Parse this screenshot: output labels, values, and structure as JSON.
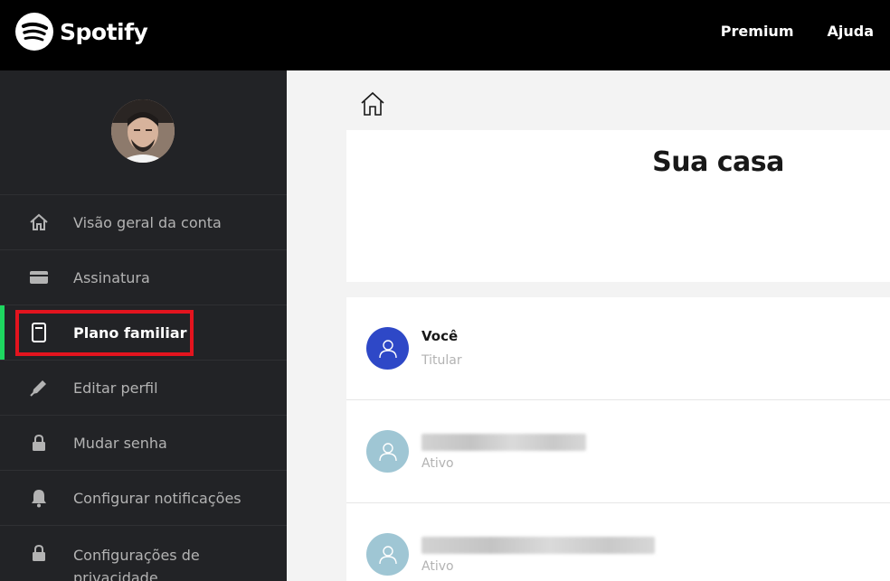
{
  "header": {
    "brand": "Spotify",
    "nav": [
      "Premium",
      "Ajuda"
    ]
  },
  "sidebar": {
    "avatar_icon": "profile-photo",
    "items": [
      {
        "label": "Visão geral da conta",
        "icon": "home-icon"
      },
      {
        "label": "Assinatura",
        "icon": "card-icon"
      },
      {
        "label": "Plano familiar",
        "icon": "family-plan-icon",
        "active": true,
        "highlighted": true
      },
      {
        "label": "Editar perfil",
        "icon": "pencil-icon"
      },
      {
        "label": "Mudar senha",
        "icon": "lock-icon"
      },
      {
        "label": "Configurar notificações",
        "icon": "bell-icon"
      },
      {
        "label": "Configurações de privacidade",
        "icon": "lock-icon"
      }
    ]
  },
  "main": {
    "home_card": {
      "icon": "house-icon",
      "title": "Sua casa"
    },
    "members": [
      {
        "name": "Você",
        "role": "Titular",
        "avatar_color": "#2e48c7"
      },
      {
        "name": "",
        "role": "Ativo",
        "avatar_color": "#9fc6d4",
        "name_blurred": true
      },
      {
        "name": "",
        "role": "Ativo",
        "avatar_color": "#9fc6d4",
        "name_blurred": true
      }
    ]
  },
  "colors": {
    "accent": "#1ed760",
    "highlight": "#e3141e",
    "topbar": "#000000",
    "sidebar": "#222326"
  }
}
